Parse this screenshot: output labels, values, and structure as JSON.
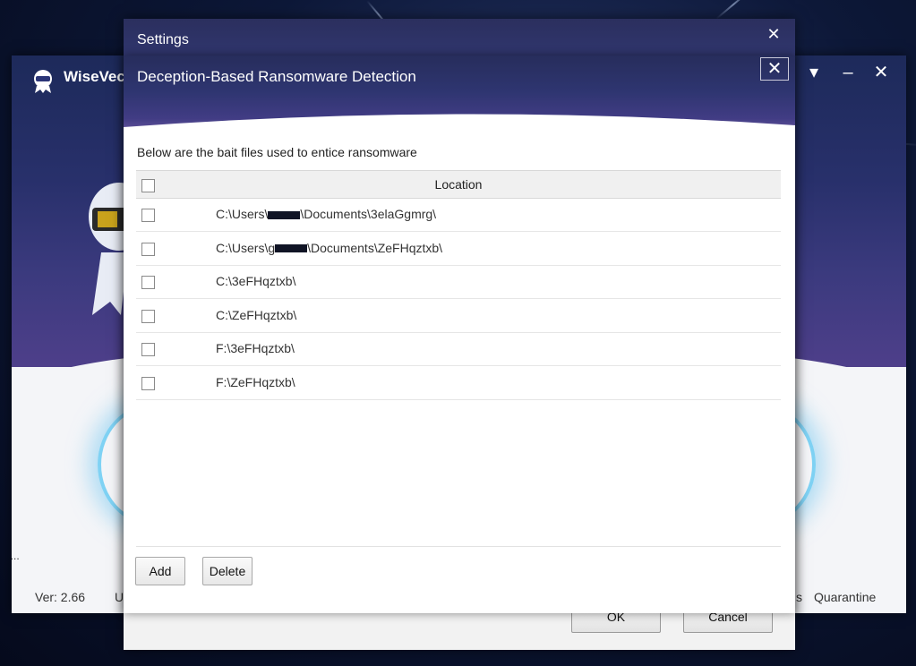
{
  "app": {
    "name": "WiseVec",
    "version": "Ver: 2.66",
    "footer_left_trunc": "U",
    "footer_right_trunc": "s",
    "quarantine": "Quarantine",
    "left_edge_text": "o...",
    "left_edge_text2": "("
  },
  "settings": {
    "title": "Settings",
    "ok_label": "OK",
    "cancel_label": "Cancel"
  },
  "dialog": {
    "title": "Deception-Based Ransomware Detection",
    "description": "Below are the bait files used to entice ransomware",
    "column_location": "Location",
    "rows": [
      {
        "prefix": "C:\\Users\\",
        "redacted": true,
        "suffix": "\\Documents\\3elaGgmrg\\"
      },
      {
        "prefix": "C:\\Users\\g",
        "redacted": true,
        "suffix": "\\Documents\\ZeFHqztxb\\"
      },
      {
        "prefix": "C:\\3eFHqztxb\\",
        "redacted": false,
        "suffix": ""
      },
      {
        "prefix": "C:\\ZeFHqztxb\\",
        "redacted": false,
        "suffix": ""
      },
      {
        "prefix": "F:\\3eFHqztxb\\",
        "redacted": false,
        "suffix": ""
      },
      {
        "prefix": "F:\\ZeFHqztxb\\",
        "redacted": false,
        "suffix": ""
      }
    ],
    "add_label": "Add",
    "delete_label": "Delete"
  },
  "icons": {
    "close": "close-icon",
    "menu": "menu-down-icon",
    "minimize": "minimize-icon",
    "logo": "wisevector-logo-icon"
  },
  "colors": {
    "header_top": "#272d5c",
    "header_bottom": "#6c5aa3",
    "ring": "#7fd2f4"
  }
}
